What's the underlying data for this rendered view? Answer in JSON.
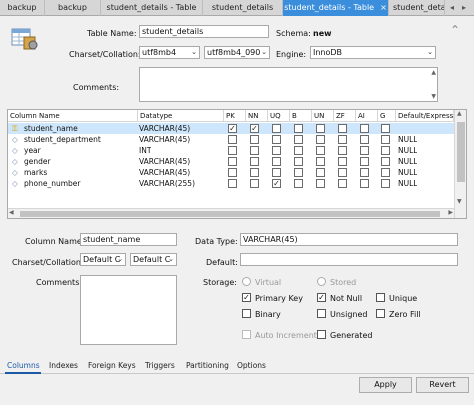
{
  "tabs": [
    {
      "label": "backup"
    },
    {
      "label": "backup"
    },
    {
      "label": "student_details - Table"
    },
    {
      "label": "student_details"
    },
    {
      "label": "student_details - Table",
      "close": "×"
    },
    {
      "label": "student_details"
    }
  ],
  "tab_arrows": {
    "left": "◂",
    "right": "▸"
  },
  "form": {
    "table_name_label": "Table Name:",
    "table_name_value": "student_details",
    "schema_label": "Schema:",
    "schema_value": "new",
    "charset_label": "Charset/Collation:",
    "charset_value": "utf8mb4",
    "collation_value": "utf8mb4_090",
    "engine_label": "Engine:",
    "engine_value": "InnoDB",
    "comments_label": "Comments:"
  },
  "grid": {
    "headers": [
      "Column Name",
      "Datatype",
      "PK",
      "NN",
      "UQ",
      "B",
      "UN",
      "ZF",
      "AI",
      "G",
      "Default/Expressio"
    ],
    "rows": [
      {
        "name": "student_name",
        "type": "VARCHAR(45)",
        "flags": [
          true,
          true,
          false,
          false,
          false,
          false,
          false,
          false
        ],
        "default": "",
        "key": true
      },
      {
        "name": "student_department",
        "type": "VARCHAR(45)",
        "flags": [
          false,
          false,
          false,
          false,
          false,
          false,
          false,
          false
        ],
        "default": "NULL",
        "key": false
      },
      {
        "name": "year",
        "type": "INT",
        "flags": [
          false,
          false,
          false,
          false,
          false,
          false,
          false,
          false
        ],
        "default": "NULL",
        "key": false
      },
      {
        "name": "gender",
        "type": "VARCHAR(45)",
        "flags": [
          false,
          false,
          false,
          false,
          false,
          false,
          false,
          false
        ],
        "default": "NULL",
        "key": false
      },
      {
        "name": "marks",
        "type": "VARCHAR(45)",
        "flags": [
          false,
          false,
          false,
          false,
          false,
          false,
          false,
          false
        ],
        "default": "NULL",
        "key": false
      },
      {
        "name": "phone_number",
        "type": "VARCHAR(255)",
        "flags": [
          false,
          false,
          true,
          false,
          false,
          false,
          false,
          false
        ],
        "default": "NULL",
        "key": false
      }
    ]
  },
  "detail": {
    "column_name_label": "Column Name:",
    "column_name_value": "student_name",
    "data_type_label": "Data Type:",
    "data_type_value": "VARCHAR(45)",
    "charset_label": "Charset/Collation:",
    "charset_value": "Default C",
    "collation_value": "Default C",
    "default_label": "Default:",
    "comments_label": "Comments:",
    "storage_label": "Storage:",
    "virtual": "Virtual",
    "stored": "Stored",
    "primary_key": "Primary Key",
    "not_null": "Not Null",
    "unique": "Unique",
    "binary": "Binary",
    "unsigned": "Unsigned",
    "zero_fill": "Zero Fill",
    "auto_increment": "Auto Increment",
    "generated": "Generated"
  },
  "bottom_tabs": [
    "Columns",
    "Indexes",
    "Foreign Keys",
    "Triggers",
    "Partitioning",
    "Options"
  ],
  "buttons": {
    "apply": "Apply",
    "revert": "Revert"
  }
}
